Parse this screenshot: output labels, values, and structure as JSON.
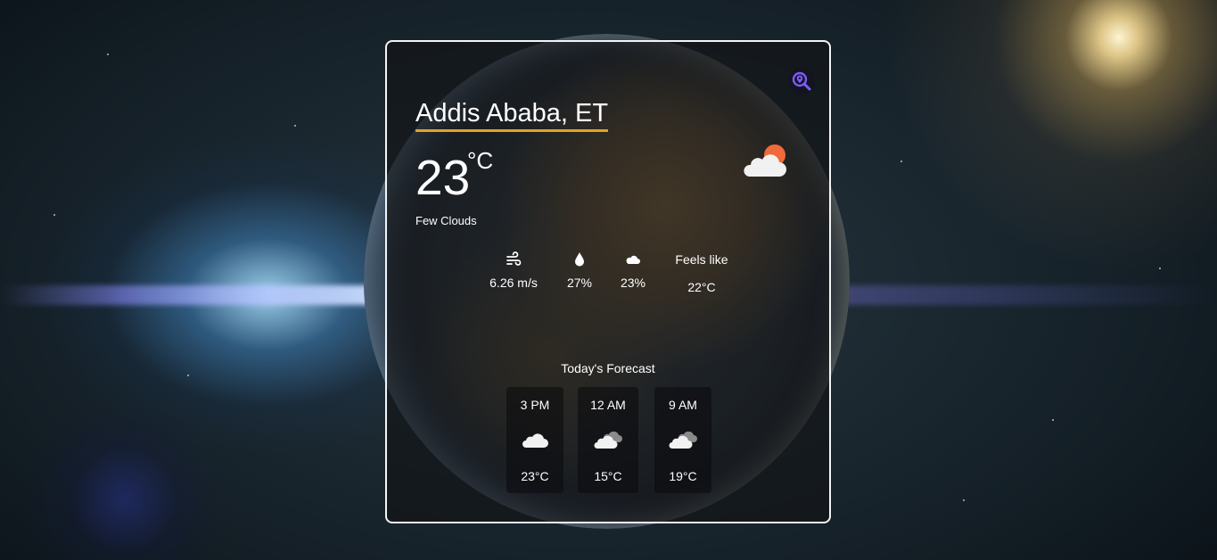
{
  "weather": {
    "city": "Addis Ababa, ET",
    "temperature": "23",
    "unit": "°C",
    "description": "Few Clouds",
    "main_icon": "cloud-sun-icon",
    "stats": {
      "wind": {
        "icon": "wind-icon",
        "value": "6.26 m/s"
      },
      "humidity": {
        "icon": "droplet-icon",
        "value": "27%"
      },
      "clouds": {
        "icon": "cloud-icon",
        "value": "23%"
      },
      "feels_like": {
        "label": "Feels like",
        "value": "22°C"
      }
    },
    "forecast_title": "Today's Forecast",
    "forecast": [
      {
        "time": "3 PM",
        "icon": "cloud-icon",
        "temp": "23°C"
      },
      {
        "time": "12 AM",
        "icon": "clouds-icon",
        "temp": "15°C"
      },
      {
        "time": "9 AM",
        "icon": "clouds-icon",
        "temp": "19°C"
      }
    ]
  },
  "colors": {
    "accent_underline": "#e2a322",
    "sun": "#f06a3b",
    "search_icon": "#7b5cff"
  }
}
